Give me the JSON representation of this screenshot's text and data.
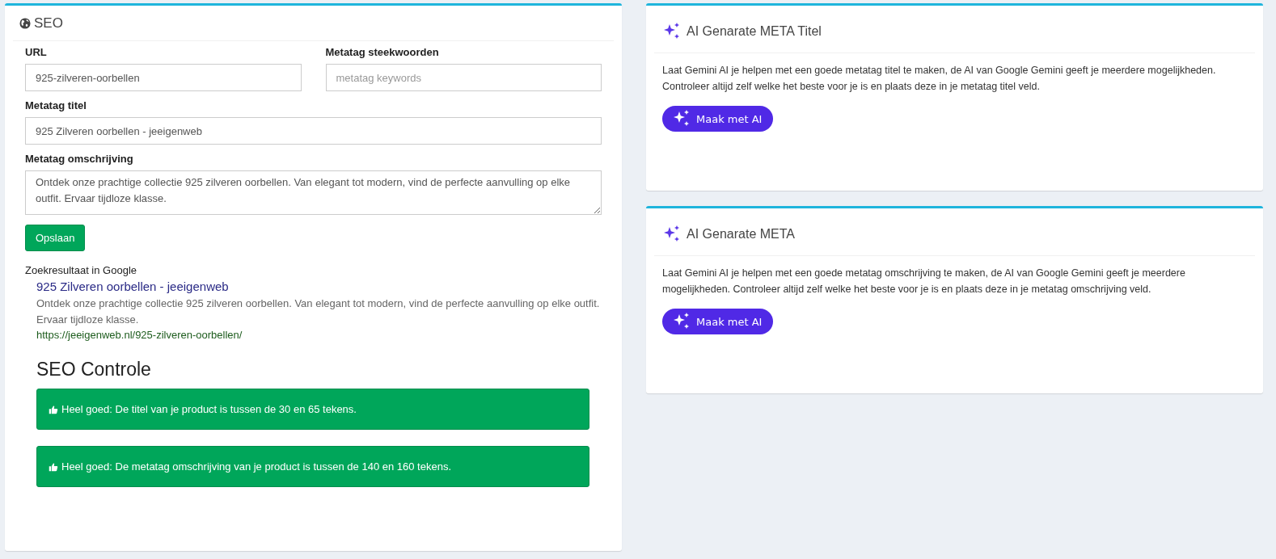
{
  "seo_panel": {
    "title": "SEO",
    "field_rows": [
      [
        {
          "kind": "input",
          "label": "URL",
          "value": "925-zilveren-oorbellen"
        },
        {
          "kind": "input",
          "label": "Metatag steekwoorden",
          "placeholder": "metatag keywords"
        }
      ],
      [
        {
          "kind": "input",
          "label": "Metatag titel",
          "value": "925 Zilveren oorbellen - jeeigenweb"
        }
      ],
      [
        {
          "kind": "textarea",
          "label": "Metatag omschrijving",
          "value": "Ontdek onze prachtige collectie 925 zilveren oorbellen. Van elegant tot modern, vind de perfecte aanvulling op elke outfit. Ervaar tijdloze klasse."
        }
      ]
    ],
    "save_button": "Opslaan",
    "preview": {
      "heading": "Zoekresultaat in Google",
      "title": "925 Zilveren oorbellen - jeeigenweb",
      "description": "Ontdek onze prachtige collectie 925 zilveren oorbellen. Van elegant tot modern, vind de perfecte aanvulling op elke outfit. Ervaar tijdloze klasse.",
      "url": "https://jeeigenweb.nl/925-zilveren-oorbellen/"
    },
    "checks_heading": "SEO Controle",
    "checks": [
      {
        "kind": "success",
        "text": "Heel goed: De titel van je product is tussen de 30 en 65 tekens."
      },
      {
        "kind": "success",
        "text": "Heel goed: De metatag omschrijving van je product is tussen de 140 en 160 tekens."
      }
    ]
  },
  "ai_panels": [
    {
      "title": "AI Genarate META Titel",
      "text": "Laat Gemini AI je helpen met een goede metatag titel te maken, de AI van Google Gemini geeft je meerdere mogelijkheden. Controleer altijd zelf welke het beste voor je is en plaats deze in je metatag titel veld.",
      "button": "Maak met AI"
    },
    {
      "title": "AI Genarate META",
      "text": "Laat Gemini AI je helpen met een goede metatag omschrijving te maken, de AI van Google Gemini geeft je meerdere mogelijkheden. Controleer altijd zelf welke het beste voor je is en plaats deze in je metatag omschrijving veld.",
      "button": "Maak met AI"
    }
  ]
}
